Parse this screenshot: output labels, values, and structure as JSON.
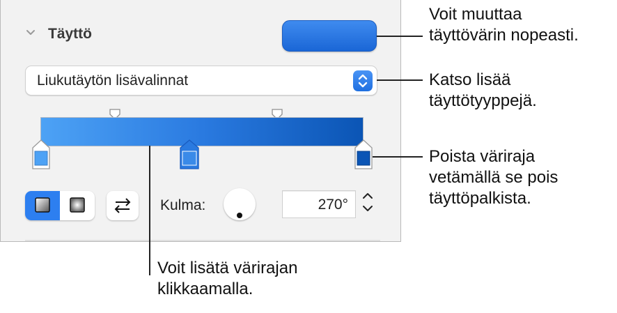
{
  "panel": {
    "section_title": "Täyttö",
    "fill_type_select": {
      "value": "Liukutäytön lisävalinnat"
    },
    "fill_color": "#2f78e6",
    "gradient": {
      "start_color": "#4da2f5",
      "end_color": "#0b55b5",
      "stop_color_middle": "#2a7ae0"
    },
    "angle": {
      "label": "Kulma:",
      "value": "270°"
    }
  },
  "callouts": {
    "fill_color": {
      "line1": "Voit muuttaa",
      "line2": "täyttövärin nopeasti."
    },
    "fill_types": {
      "line1": "Katso lisää",
      "line2": "täyttötyyppejä."
    },
    "remove_stop": {
      "line1": "Poista väriraja",
      "line2": "vetämällä se pois",
      "line3": "täyttöpalkista."
    },
    "add_stop": {
      "line1": "Voit lisätä värirajan",
      "line2": "klikkaamalla."
    }
  }
}
